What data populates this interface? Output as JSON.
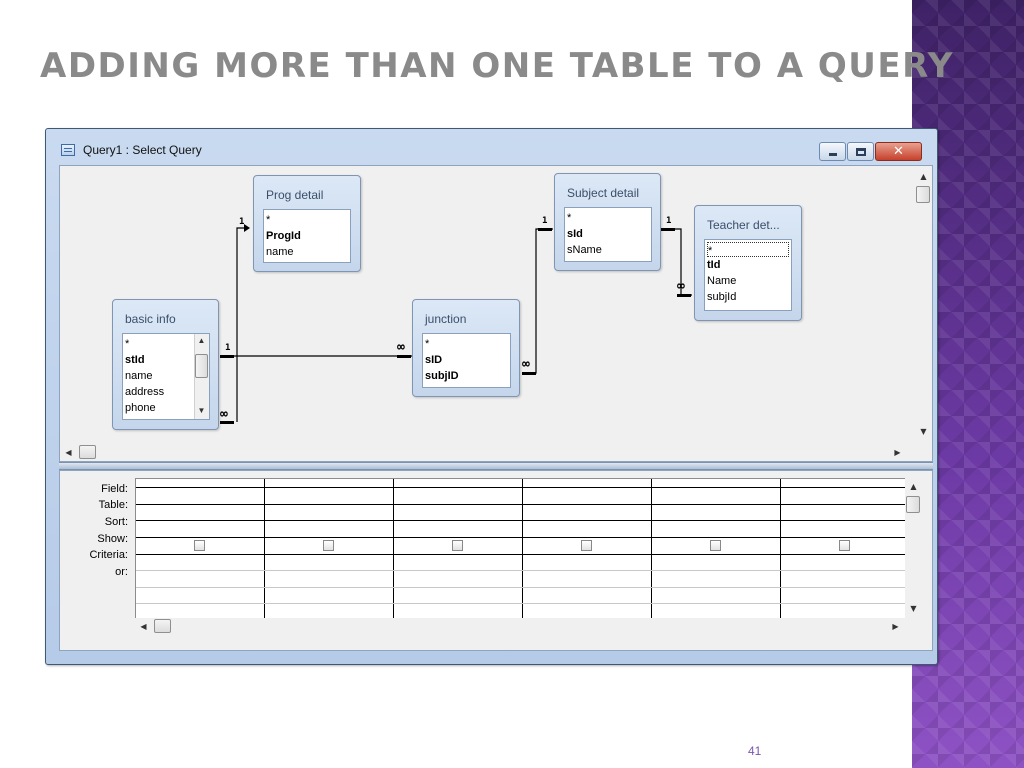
{
  "slide": {
    "title": "Adding more than one table to a Query",
    "page_number": "41",
    "accent_color": "#6b3d9c",
    "title_color": "#8a8a8a"
  },
  "window": {
    "title": "Query1 : Select Query",
    "icon": "query-design-icon",
    "buttons": {
      "minimize": "minimize-icon",
      "maximize": "maximize-icon",
      "close": "✕"
    }
  },
  "tables": {
    "prog_detail": {
      "title": "Prog detail",
      "fields": [
        "*",
        "ProgId",
        "name"
      ],
      "primary_key": "ProgId"
    },
    "basic_info": {
      "title": "basic info",
      "fields": [
        "*",
        "stId",
        "name",
        "address",
        "phone"
      ],
      "primary_key": "stId"
    },
    "junction": {
      "title": "junction",
      "fields": [
        "*",
        "sID",
        "subjID"
      ],
      "primary_key": [
        "sID",
        "subjID"
      ]
    },
    "subject_detail": {
      "title": "Subject detail",
      "fields": [
        "*",
        "sId",
        "sName"
      ],
      "primary_key": "sId"
    },
    "teacher_detail": {
      "title": "Teacher det...",
      "fields": [
        "*",
        "tId",
        "Name",
        "subjId"
      ],
      "primary_key": "tId"
    }
  },
  "relationships": [
    {
      "from": "basic info",
      "from_end": "∞",
      "to": "Prog detail",
      "to_end": "1"
    },
    {
      "from": "basic info",
      "from_end": "1",
      "to": "junction",
      "to_end": "∞"
    },
    {
      "from": "junction",
      "from_end": "∞",
      "to": "Subject detail",
      "to_end": "1"
    },
    {
      "from": "Subject detail",
      "from_end": "1",
      "to": "Teacher det...",
      "to_end": "∞"
    }
  ],
  "join_labels": {
    "one": "1",
    "many": "∞"
  },
  "grid": {
    "row_labels": [
      "Field:",
      "Table:",
      "Sort:",
      "Show:",
      "Criteria:",
      "or:"
    ],
    "columns": 6
  }
}
